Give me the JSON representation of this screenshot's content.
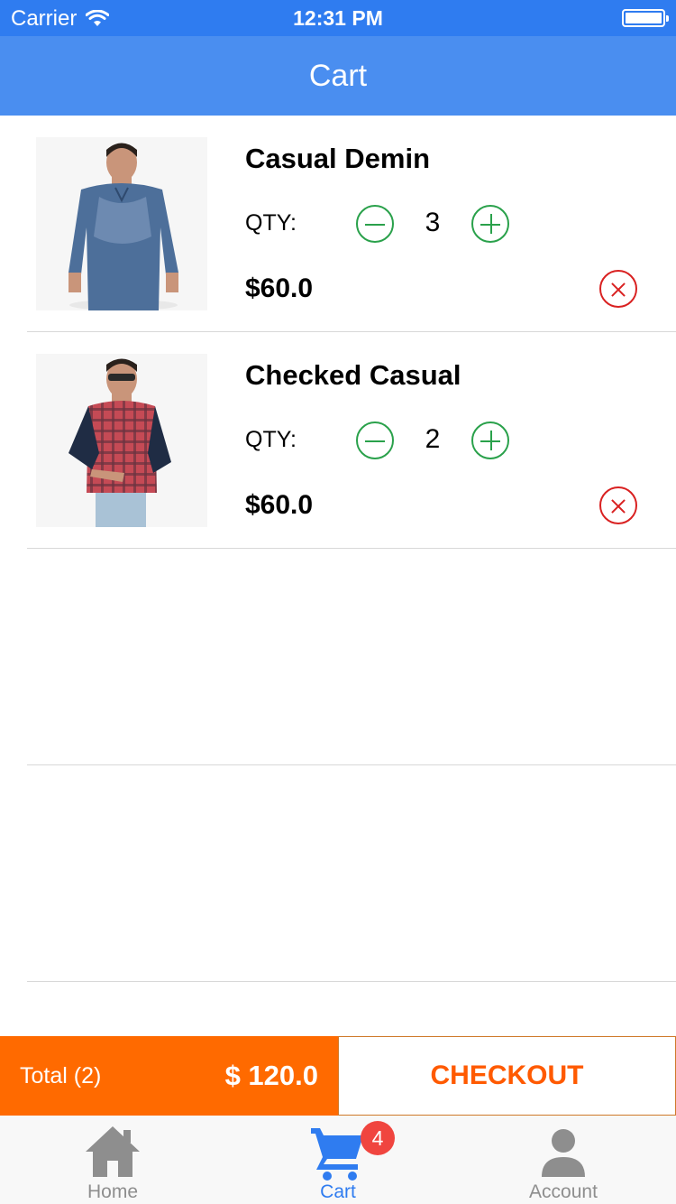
{
  "status_bar": {
    "carrier": "Carrier",
    "time": "12:31 PM"
  },
  "nav": {
    "title": "Cart"
  },
  "cart": {
    "qty_label": "QTY:",
    "items": [
      {
        "title": "Casual Demin",
        "qty": "3",
        "price": "$60.0",
        "image": "denim-shirt-model"
      },
      {
        "title": "Checked Casual",
        "qty": "2",
        "price": "$60.0",
        "image": "checked-shirt-model"
      }
    ]
  },
  "summary": {
    "total_label": "Total (2)",
    "total_amount": "$ 120.0",
    "checkout_label": "CHECKOUT"
  },
  "tabs": {
    "home": {
      "label": "Home",
      "icon": "home-icon"
    },
    "cart": {
      "label": "Cart",
      "icon": "cart-icon",
      "badge": "4"
    },
    "account": {
      "label": "Account",
      "icon": "account-icon"
    }
  },
  "colors": {
    "status_bar": "#2f7cf0",
    "nav_bar": "#4a8ef0",
    "accent_orange": "#ff6a00",
    "qty_green": "#2aa14b",
    "remove_red": "#d92121",
    "tab_active": "#2f7cf0",
    "badge": "#f0453f"
  }
}
